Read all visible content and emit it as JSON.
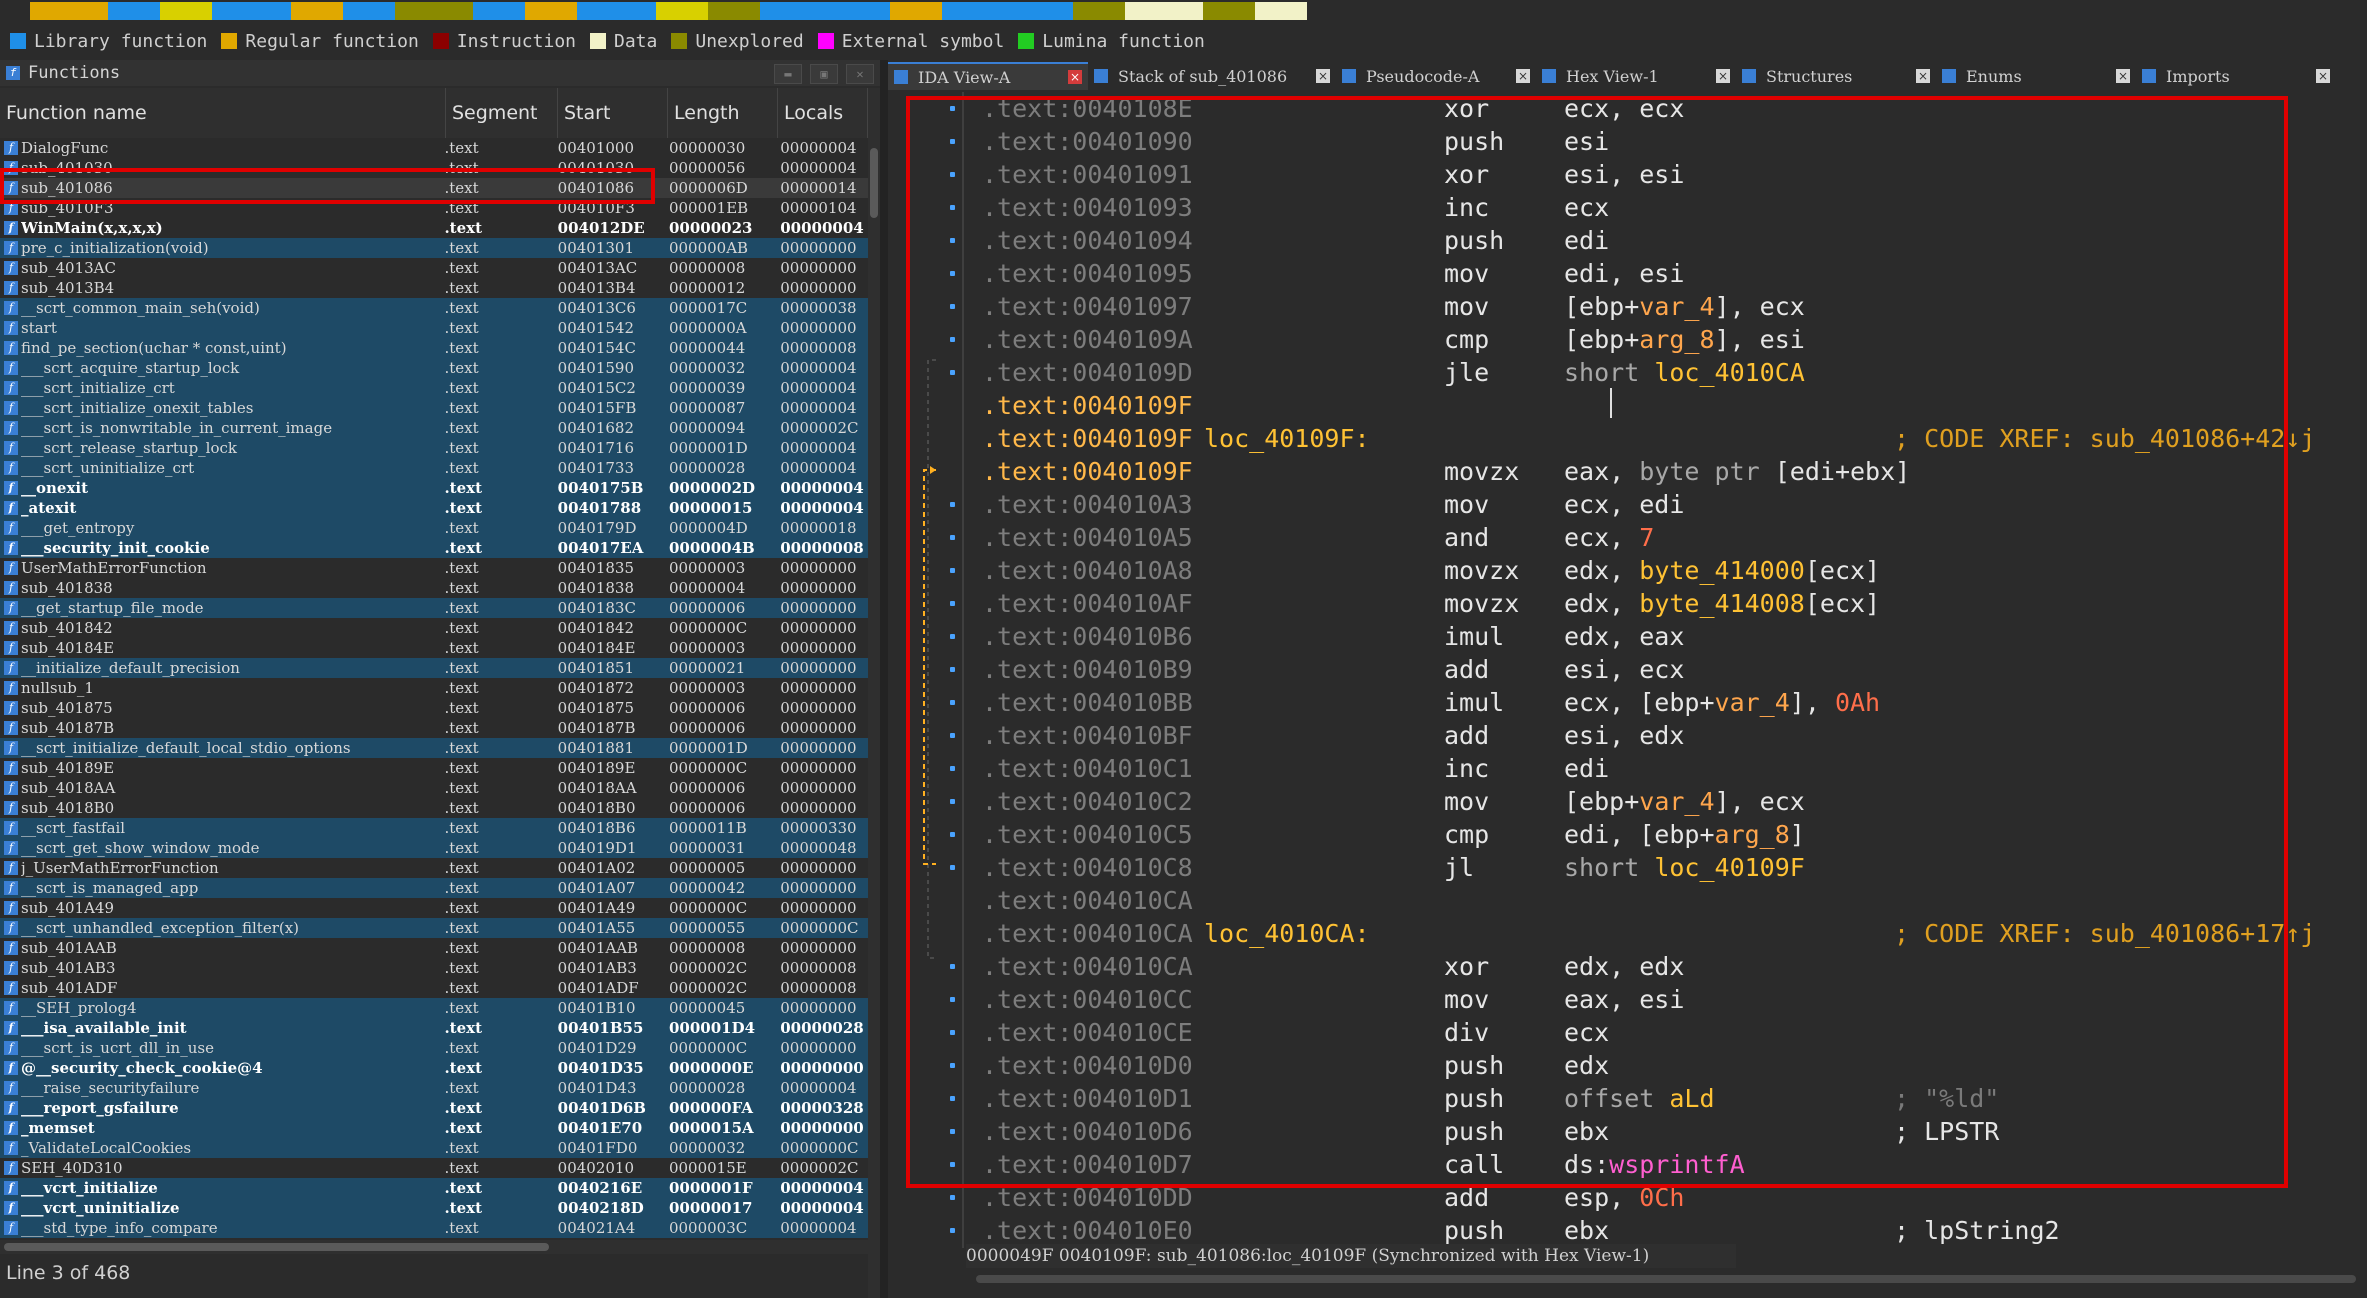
{
  "nav_colors": [
    "#e0a800",
    "#1f8fe8",
    "#d8d000",
    "#1f8fe8",
    "#e0a800",
    "#1f8fe8",
    "#8a8a00",
    "#1f8fe8",
    "#e0a800",
    "#1f8fe8",
    "#d8d000",
    "#8a8a00",
    "#1f8fe8",
    "#1f8fe8",
    "#e0a800",
    "#1f8fe8",
    "#1f8fe8",
    "#8a8a00",
    "#f2f2c8",
    "#8a8a00",
    "#f2f2c8",
    "#2b2b2b"
  ],
  "legend": [
    {
      "label": "Library function",
      "color": "#1f8fe8"
    },
    {
      "label": "Regular function",
      "color": "#e0a800"
    },
    {
      "label": "Instruction",
      "color": "#8b0000"
    },
    {
      "label": "Data",
      "color": "#f2f2c8"
    },
    {
      "label": "Unexplored",
      "color": "#8a8a00"
    },
    {
      "label": "External symbol",
      "color": "#ff00ff"
    },
    {
      "label": "Lumina function",
      "color": "#22cc22"
    }
  ],
  "functions_pane": {
    "title": "Functions",
    "columns": [
      "Function name",
      "Segment",
      "Start",
      "Length",
      "Locals"
    ],
    "status": "Line 3 of 468",
    "rows": [
      {
        "name": "DialogFunc",
        "seg": ".text",
        "start": "00401000",
        "len": "00000030",
        "loc": "00000004",
        "hl": false,
        "bold": false
      },
      {
        "name": "sub_401030",
        "seg": ".text",
        "start": "00401030",
        "len": "00000056",
        "loc": "00000004",
        "hl": false,
        "bold": false
      },
      {
        "name": "sub_401086",
        "seg": ".text",
        "start": "00401086",
        "len": "0000006D",
        "loc": "00000014",
        "hl": false,
        "bold": false,
        "sel": true
      },
      {
        "name": "sub_4010F3",
        "seg": ".text",
        "start": "004010F3",
        "len": "000001EB",
        "loc": "00000104",
        "hl": false,
        "bold": false
      },
      {
        "name": "WinMain(x,x,x,x)",
        "seg": ".text",
        "start": "004012DE",
        "len": "00000023",
        "loc": "00000004",
        "hl": false,
        "bold": true
      },
      {
        "name": "pre_c_initialization(void)",
        "seg": ".text",
        "start": "00401301",
        "len": "000000AB",
        "loc": "00000000",
        "hl": true,
        "bold": false
      },
      {
        "name": "sub_4013AC",
        "seg": ".text",
        "start": "004013AC",
        "len": "00000008",
        "loc": "00000000",
        "hl": false,
        "bold": false
      },
      {
        "name": "sub_4013B4",
        "seg": ".text",
        "start": "004013B4",
        "len": "00000012",
        "loc": "00000000",
        "hl": false,
        "bold": false
      },
      {
        "name": "__scrt_common_main_seh(void)",
        "seg": ".text",
        "start": "004013C6",
        "len": "0000017C",
        "loc": "00000038",
        "hl": true,
        "bold": false
      },
      {
        "name": "start",
        "seg": ".text",
        "start": "00401542",
        "len": "0000000A",
        "loc": "00000000",
        "hl": true,
        "bold": false
      },
      {
        "name": "find_pe_section(uchar * const,uint)",
        "seg": ".text",
        "start": "0040154C",
        "len": "00000044",
        "loc": "00000008",
        "hl": true,
        "bold": false
      },
      {
        "name": "___scrt_acquire_startup_lock",
        "seg": ".text",
        "start": "00401590",
        "len": "00000032",
        "loc": "00000004",
        "hl": true,
        "bold": false
      },
      {
        "name": "___scrt_initialize_crt",
        "seg": ".text",
        "start": "004015C2",
        "len": "00000039",
        "loc": "00000004",
        "hl": true,
        "bold": false
      },
      {
        "name": "___scrt_initialize_onexit_tables",
        "seg": ".text",
        "start": "004015FB",
        "len": "00000087",
        "loc": "00000004",
        "hl": true,
        "bold": false
      },
      {
        "name": "___scrt_is_nonwritable_in_current_image",
        "seg": ".text",
        "start": "00401682",
        "len": "00000094",
        "loc": "0000002C",
        "hl": true,
        "bold": false
      },
      {
        "name": "___scrt_release_startup_lock",
        "seg": ".text",
        "start": "00401716",
        "len": "0000001D",
        "loc": "00000004",
        "hl": true,
        "bold": false
      },
      {
        "name": "___scrt_uninitialize_crt",
        "seg": ".text",
        "start": "00401733",
        "len": "00000028",
        "loc": "00000004",
        "hl": true,
        "bold": false
      },
      {
        "name": "__onexit",
        "seg": ".text",
        "start": "0040175B",
        "len": "0000002D",
        "loc": "00000004",
        "hl": true,
        "bold": true
      },
      {
        "name": "_atexit",
        "seg": ".text",
        "start": "00401788",
        "len": "00000015",
        "loc": "00000004",
        "hl": true,
        "bold": true
      },
      {
        "name": "___get_entropy",
        "seg": ".text",
        "start": "0040179D",
        "len": "0000004D",
        "loc": "00000018",
        "hl": true,
        "bold": false
      },
      {
        "name": "___security_init_cookie",
        "seg": ".text",
        "start": "004017EA",
        "len": "0000004B",
        "loc": "00000008",
        "hl": true,
        "bold": true
      },
      {
        "name": "UserMathErrorFunction",
        "seg": ".text",
        "start": "00401835",
        "len": "00000003",
        "loc": "00000000",
        "hl": false,
        "bold": false
      },
      {
        "name": "sub_401838",
        "seg": ".text",
        "start": "00401838",
        "len": "00000004",
        "loc": "00000000",
        "hl": false,
        "bold": false
      },
      {
        "name": "__get_startup_file_mode",
        "seg": ".text",
        "start": "0040183C",
        "len": "00000006",
        "loc": "00000000",
        "hl": true,
        "bold": false
      },
      {
        "name": "sub_401842",
        "seg": ".text",
        "start": "00401842",
        "len": "0000000C",
        "loc": "00000000",
        "hl": false,
        "bold": false
      },
      {
        "name": "sub_40184E",
        "seg": ".text",
        "start": "0040184E",
        "len": "00000003",
        "loc": "00000000",
        "hl": false,
        "bold": false
      },
      {
        "name": "__initialize_default_precision",
        "seg": ".text",
        "start": "00401851",
        "len": "00000021",
        "loc": "00000000",
        "hl": true,
        "bold": false
      },
      {
        "name": "nullsub_1",
        "seg": ".text",
        "start": "00401872",
        "len": "00000003",
        "loc": "00000000",
        "hl": false,
        "bold": false
      },
      {
        "name": "sub_401875",
        "seg": ".text",
        "start": "00401875",
        "len": "00000006",
        "loc": "00000000",
        "hl": false,
        "bold": false
      },
      {
        "name": "sub_40187B",
        "seg": ".text",
        "start": "0040187B",
        "len": "00000006",
        "loc": "00000000",
        "hl": false,
        "bold": false
      },
      {
        "name": "__scrt_initialize_default_local_stdio_options",
        "seg": ".text",
        "start": "00401881",
        "len": "0000001D",
        "loc": "00000000",
        "hl": true,
        "bold": false
      },
      {
        "name": "sub_40189E",
        "seg": ".text",
        "start": "0040189E",
        "len": "0000000C",
        "loc": "00000000",
        "hl": false,
        "bold": false
      },
      {
        "name": "sub_4018AA",
        "seg": ".text",
        "start": "004018AA",
        "len": "00000006",
        "loc": "00000000",
        "hl": false,
        "bold": false
      },
      {
        "name": "sub_4018B0",
        "seg": ".text",
        "start": "004018B0",
        "len": "00000006",
        "loc": "00000000",
        "hl": false,
        "bold": false
      },
      {
        "name": "__scrt_fastfail",
        "seg": ".text",
        "start": "004018B6",
        "len": "0000011B",
        "loc": "00000330",
        "hl": true,
        "bold": false
      },
      {
        "name": "__scrt_get_show_window_mode",
        "seg": ".text",
        "start": "004019D1",
        "len": "00000031",
        "loc": "00000048",
        "hl": true,
        "bold": false
      },
      {
        "name": "j_UserMathErrorFunction",
        "seg": ".text",
        "start": "00401A02",
        "len": "00000005",
        "loc": "00000000",
        "hl": false,
        "bold": false
      },
      {
        "name": "__scrt_is_managed_app",
        "seg": ".text",
        "start": "00401A07",
        "len": "00000042",
        "loc": "00000000",
        "hl": true,
        "bold": false
      },
      {
        "name": "sub_401A49",
        "seg": ".text",
        "start": "00401A49",
        "len": "0000000C",
        "loc": "00000000",
        "hl": false,
        "bold": false
      },
      {
        "name": "__scrt_unhandled_exception_filter(x)",
        "seg": ".text",
        "start": "00401A55",
        "len": "00000055",
        "loc": "0000000C",
        "hl": true,
        "bold": false
      },
      {
        "name": "sub_401AAB",
        "seg": ".text",
        "start": "00401AAB",
        "len": "00000008",
        "loc": "00000000",
        "hl": false,
        "bold": false
      },
      {
        "name": "sub_401AB3",
        "seg": ".text",
        "start": "00401AB3",
        "len": "0000002C",
        "loc": "00000008",
        "hl": false,
        "bold": false
      },
      {
        "name": "sub_401ADF",
        "seg": ".text",
        "start": "00401ADF",
        "len": "0000002C",
        "loc": "00000008",
        "hl": false,
        "bold": false
      },
      {
        "name": "__SEH_prolog4",
        "seg": ".text",
        "start": "00401B10",
        "len": "00000045",
        "loc": "00000000",
        "hl": true,
        "bold": false
      },
      {
        "name": "___isa_available_init",
        "seg": ".text",
        "start": "00401B55",
        "len": "000001D4",
        "loc": "00000028",
        "hl": true,
        "bold": true
      },
      {
        "name": "___scrt_is_ucrt_dll_in_use",
        "seg": ".text",
        "start": "00401D29",
        "len": "0000000C",
        "loc": "00000000",
        "hl": true,
        "bold": false
      },
      {
        "name": "@__security_check_cookie@4",
        "seg": ".text",
        "start": "00401D35",
        "len": "0000000E",
        "loc": "00000000",
        "hl": true,
        "bold": true
      },
      {
        "name": "___raise_securityfailure",
        "seg": ".text",
        "start": "00401D43",
        "len": "00000028",
        "loc": "00000004",
        "hl": true,
        "bold": false
      },
      {
        "name": "___report_gsfailure",
        "seg": ".text",
        "start": "00401D6B",
        "len": "000000FA",
        "loc": "00000328",
        "hl": true,
        "bold": true
      },
      {
        "name": "_memset",
        "seg": ".text",
        "start": "00401E70",
        "len": "0000015A",
        "loc": "00000000",
        "hl": true,
        "bold": true
      },
      {
        "name": "_ValidateLocalCookies",
        "seg": ".text",
        "start": "00401FD0",
        "len": "00000032",
        "loc": "0000000C",
        "hl": true,
        "bold": false
      },
      {
        "name": "SEH_40D310",
        "seg": ".text",
        "start": "00402010",
        "len": "0000015E",
        "loc": "0000002C",
        "hl": false,
        "bold": false
      },
      {
        "name": "___vcrt_initialize",
        "seg": ".text",
        "start": "0040216E",
        "len": "0000001F",
        "loc": "00000004",
        "hl": true,
        "bold": true
      },
      {
        "name": "___vcrt_uninitialize",
        "seg": ".text",
        "start": "0040218D",
        "len": "00000017",
        "loc": "00000004",
        "hl": true,
        "bold": true
      },
      {
        "name": "___std_type_info_compare",
        "seg": ".text",
        "start": "004021A4",
        "len": "0000003C",
        "loc": "00000004",
        "hl": true,
        "bold": false
      }
    ]
  },
  "tabs": [
    {
      "label": "IDA View-A",
      "active": true
    },
    {
      "label": "Stack of sub_401086",
      "active": false
    },
    {
      "label": "Pseudocode-A",
      "active": false
    },
    {
      "label": "Hex View-1",
      "active": false
    },
    {
      "label": "Structures",
      "active": false
    },
    {
      "label": "Enums",
      "active": false
    },
    {
      "label": "Imports",
      "active": false
    }
  ],
  "disasm": [
    {
      "addr": ".text:0040108E",
      "mn": "xor",
      "ops": "ecx, ecx",
      "dot": true
    },
    {
      "addr": ".text:00401090",
      "mn": "push",
      "ops": "esi",
      "dot": true
    },
    {
      "addr": ".text:00401091",
      "mn": "xor",
      "ops": "esi, esi",
      "dot": true
    },
    {
      "addr": ".text:00401093",
      "mn": "inc",
      "ops": "ecx",
      "dot": true
    },
    {
      "addr": ".text:00401094",
      "mn": "push",
      "ops": "edi",
      "dot": true
    },
    {
      "addr": ".text:00401095",
      "mn": "mov",
      "ops": "edi, esi",
      "dot": true
    },
    {
      "addr": ".text:00401097",
      "mn": "mov",
      "ops": "[ebp+var_4], ecx",
      "dot": true
    },
    {
      "addr": ".text:0040109A",
      "mn": "cmp",
      "ops": "[ebp+arg_8], esi",
      "dot": true
    },
    {
      "addr": ".text:0040109D",
      "mn": "jle",
      "ops": "short loc_4010CA",
      "dot": true
    },
    {
      "addr": ".text:0040109F",
      "cur": true
    },
    {
      "addr": ".text:0040109F",
      "cur": true,
      "label": "loc_40109F:",
      "comment": "; CODE XREF: sub_401086+42↓j"
    },
    {
      "addr": ".text:0040109F",
      "cur": true,
      "mn": "movzx",
      "ops": "eax, byte ptr [edi+ebx]"
    },
    {
      "addr": ".text:004010A3",
      "mn": "mov",
      "ops": "ecx, edi",
      "dot": true
    },
    {
      "addr": ".text:004010A5",
      "mn": "and",
      "ops": "ecx, 7",
      "dot": true
    },
    {
      "addr": ".text:004010A8",
      "mn": "movzx",
      "ops": "edx, byte_414000[ecx]",
      "dot": true
    },
    {
      "addr": ".text:004010AF",
      "mn": "movzx",
      "ops": "edx, byte_414008[ecx]",
      "dot": true
    },
    {
      "addr": ".text:004010B6",
      "mn": "imul",
      "ops": "edx, eax",
      "dot": true
    },
    {
      "addr": ".text:004010B9",
      "mn": "add",
      "ops": "esi, ecx",
      "dot": true
    },
    {
      "addr": ".text:004010BB",
      "mn": "imul",
      "ops": "ecx, [ebp+var_4], 0Ah",
      "dot": true
    },
    {
      "addr": ".text:004010BF",
      "mn": "add",
      "ops": "esi, edx",
      "dot": true
    },
    {
      "addr": ".text:004010C1",
      "mn": "inc",
      "ops": "edi",
      "dot": true
    },
    {
      "addr": ".text:004010C2",
      "mn": "mov",
      "ops": "[ebp+var_4], ecx",
      "dot": true
    },
    {
      "addr": ".text:004010C5",
      "mn": "cmp",
      "ops": "edi, [ebp+arg_8]",
      "dot": true
    },
    {
      "addr": ".text:004010C8",
      "mn": "jl",
      "ops": "short loc_40109F",
      "dot": true
    },
    {
      "addr": ".text:004010CA"
    },
    {
      "addr": ".text:004010CA",
      "label": "loc_4010CA:",
      "comment": "; CODE XREF: sub_401086+17↑j"
    },
    {
      "addr": ".text:004010CA",
      "mn": "xor",
      "ops": "edx, edx",
      "dot": true
    },
    {
      "addr": ".text:004010CC",
      "mn": "mov",
      "ops": "eax, esi",
      "dot": true
    },
    {
      "addr": ".text:004010CE",
      "mn": "div",
      "ops": "ecx",
      "dot": true
    },
    {
      "addr": ".text:004010D0",
      "mn": "push",
      "ops": "edx",
      "dot": true
    },
    {
      "addr": ".text:004010D1",
      "mn": "push",
      "ops": "offset aLd",
      "comment": "; \"%ld\"",
      "ctype": "str",
      "dot": true
    },
    {
      "addr": ".text:004010D6",
      "mn": "push",
      "ops": "ebx",
      "comment": "; LPSTR",
      "ctype": "w",
      "dot": true
    },
    {
      "addr": ".text:004010D7",
      "mn": "call",
      "ops": "ds:wsprintfA",
      "dot": true
    },
    {
      "addr": ".text:004010DD",
      "mn": "add",
      "ops": "esp, 0Ch",
      "dot": true
    },
    {
      "addr": ".text:004010E0",
      "mn": "push",
      "ops": "ebx",
      "comment": "; lpString2",
      "ctype": "w",
      "dot": true
    }
  ],
  "bottom_status": "0000049F 0040109F: sub_401086:loc_40109F (Synchronized with Hex View-1)"
}
